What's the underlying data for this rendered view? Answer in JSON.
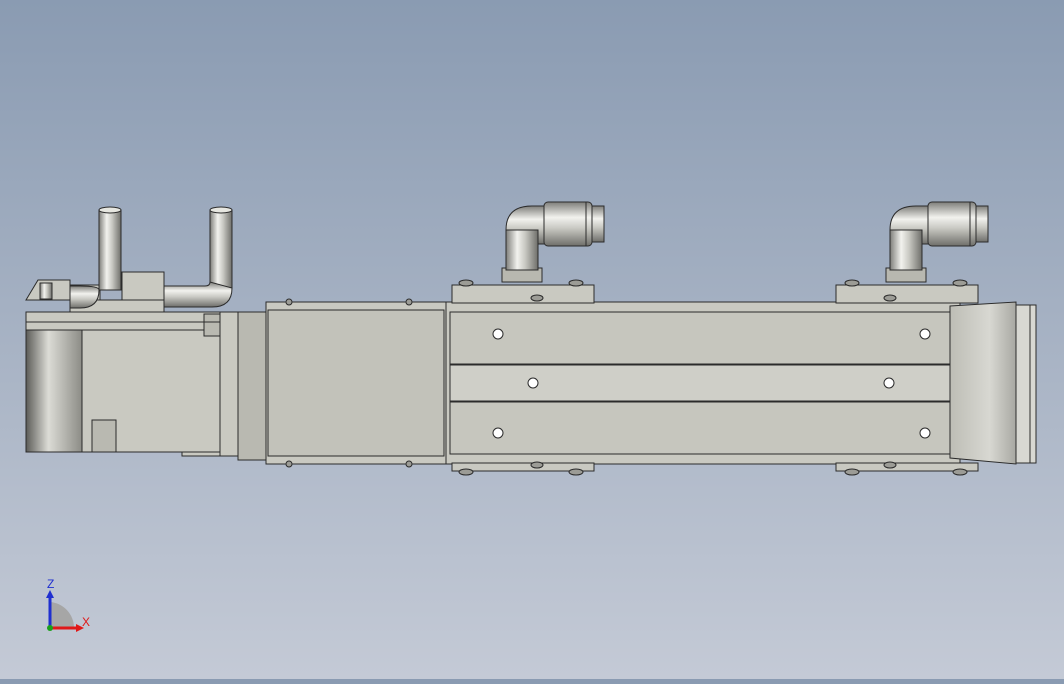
{
  "viewport": {
    "background_top": "#8a9bb2",
    "background_bottom": "#c4cad6",
    "model_fill": "#c9c9c1",
    "model_fill_dark": "#b9b9b1",
    "edge_color": "#2b2b2b"
  },
  "triad": {
    "z_label": "Z",
    "x_label": "X",
    "z_color": "#1f2fd0",
    "x_color": "#e01818",
    "icon": "coordinate-triad-icon"
  }
}
